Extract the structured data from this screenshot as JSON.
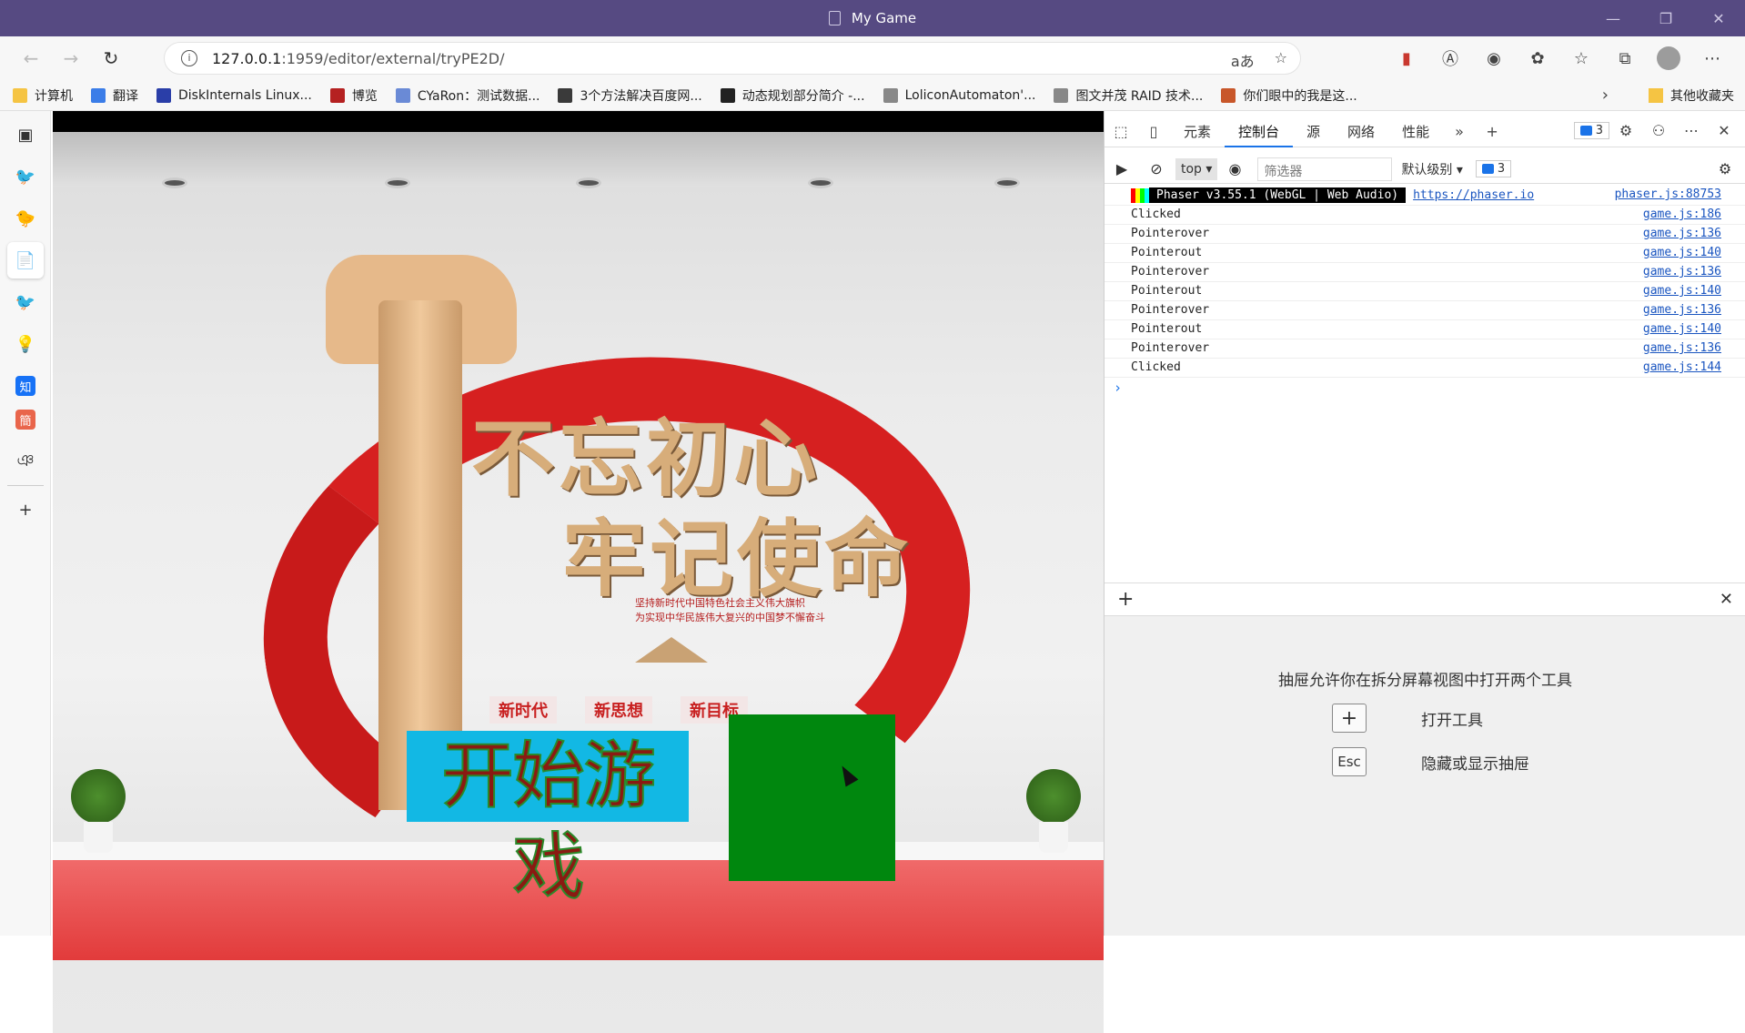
{
  "window": {
    "title": "My Game",
    "min": "—",
    "max": "❐",
    "close": "✕"
  },
  "address": {
    "host": "127.0.0.1",
    "path": ":1959/editor/external/tryPE2D/",
    "read_aloud": "aあ"
  },
  "favorites": [
    {
      "label": "计算机",
      "color": "#f5c443"
    },
    {
      "label": "翻译",
      "color": "#3b7de8"
    },
    {
      "label": "DiskInternals Linux...",
      "color": "#2a3ea8"
    },
    {
      "label": "博览",
      "color": "#b52121"
    },
    {
      "label": "CYaRon：测试数据...",
      "color": "#6a8ad6"
    },
    {
      "label": "3个方法解决百度网...",
      "color": "#3a3a3a"
    },
    {
      "label": "动态规划部分简介 -...",
      "color": "#222222"
    },
    {
      "label": "LoliconAutomaton'...",
      "color": "#888888"
    },
    {
      "label": "图文并茂 RAID 技术...",
      "color": "#888888"
    },
    {
      "label": "你们眼中的我是这...",
      "color": "#c8572a"
    }
  ],
  "favorites_other": "其他收藏夹",
  "sidebar": [
    "tabs-icon",
    "pet-icon",
    "bird-icon",
    "page-icon",
    "pet2-icon",
    "bulb-icon",
    "zhihu-icon",
    "jian-icon",
    "script-icon",
    "add-icon"
  ],
  "sidebar_glyphs": [
    "▣",
    "🐦",
    "🐤",
    "📄",
    "🐦",
    "💡",
    "知",
    "簡",
    "ঞ",
    "+"
  ],
  "game": {
    "slogan_line1": "不忘初心",
    "slogan_line2": "牢记使命",
    "small_text_1": "坚持新时代中国特色社会主义伟大旗帜",
    "small_text_2": "为实现中华民族伟大复兴的中国梦不懈奋斗",
    "tags": [
      "新时代",
      "新思想",
      "新目标"
    ],
    "start_button": "开始游戏",
    "colors": {
      "start_bg": "#12b8e4",
      "start_text": "#8a1a12",
      "square": "#00870e"
    }
  },
  "devtools": {
    "tabs": [
      "元素",
      "控制台",
      "源",
      "网络",
      "性能"
    ],
    "active_tab": "控制台",
    "issues_count": "3",
    "context": "top",
    "filter_placeholder": "筛选器",
    "levels": "默认级别",
    "phaser_badge": "Phaser v3.55.1 (WebGL | Web Audio)",
    "phaser_link": "https://phaser.io",
    "phaser_src": "phaser.js:88753",
    "logs": [
      {
        "msg": "Clicked",
        "src": "game.js:186"
      },
      {
        "msg": "Pointerover",
        "src": "game.js:136"
      },
      {
        "msg": "Pointerout",
        "src": "game.js:140"
      },
      {
        "msg": "Pointerover",
        "src": "game.js:136"
      },
      {
        "msg": "Pointerout",
        "src": "game.js:140"
      },
      {
        "msg": "Pointerover",
        "src": "game.js:136"
      },
      {
        "msg": "Pointerout",
        "src": "game.js:140"
      },
      {
        "msg": "Pointerover",
        "src": "game.js:136"
      },
      {
        "msg": "Clicked",
        "src": "game.js:144"
      }
    ],
    "prompt": "›",
    "drawer": {
      "message": "抽屉允许你在拆分屏幕视图中打开两个工具",
      "open_key": "+",
      "open_label": "打开工具",
      "toggle_key": "Esc",
      "toggle_label": "隐藏或显示抽屉"
    }
  }
}
